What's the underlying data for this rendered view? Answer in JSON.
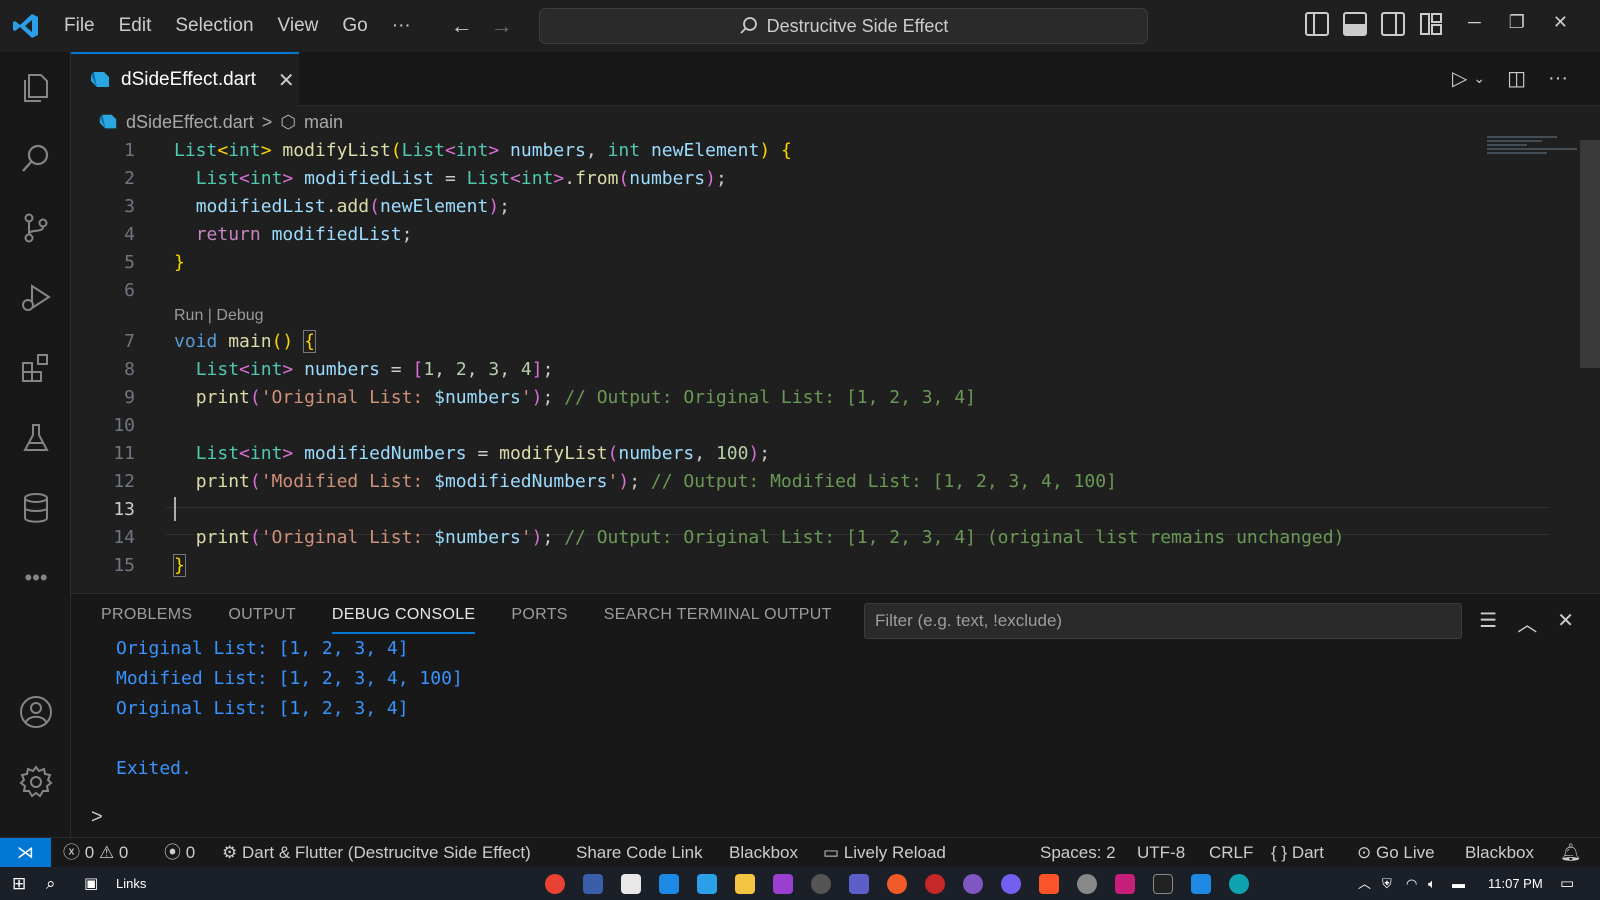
{
  "menu": [
    "File",
    "Edit",
    "Selection",
    "View",
    "Go",
    "···"
  ],
  "search": {
    "label": "Destrucitve Side Effect"
  },
  "tab": {
    "filename": "dSideEffect.dart",
    "close": "✕"
  },
  "breadcrumb": {
    "file": "dSideEffect.dart",
    "sep": ">",
    "symbol": "main"
  },
  "editor": {
    "codelens": "Run | Debug",
    "line_numbers": [
      "1",
      "2",
      "3",
      "4",
      "5",
      "6",
      "7",
      "8",
      "9",
      "10",
      "11",
      "12",
      "13",
      "14",
      "15"
    ],
    "active_line": "13"
  },
  "panel": {
    "tabs": [
      "PROBLEMS",
      "OUTPUT",
      "DEBUG CONSOLE",
      "PORTS",
      "SEARCH TERMINAL OUTPUT"
    ],
    "active_tab": "DEBUG CONSOLE",
    "filter_placeholder": "Filter (e.g. text, !exclude)",
    "console_lines": [
      "Original List: [1, 2, 3, 4]",
      "Modified List: [1, 2, 3, 4, 100]",
      "Original List: [1, 2, 3, 4]",
      "",
      "Exited."
    ],
    "prompt": ">"
  },
  "status": {
    "errors": "0",
    "warnings": "0",
    "ports": "0",
    "debug_target": "Dart & Flutter (Destrucitve Side Effect)",
    "share": "Share Code Link",
    "blackbox1": "Blackbox",
    "lively": "Lively Reload",
    "spaces": "Spaces: 2",
    "encoding": "UTF-8",
    "eol": "CRLF",
    "language": "Dart",
    "golive": "Go Live",
    "blackbox2": "Blackbox"
  },
  "taskbar": {
    "links": "Links",
    "time": "11:07 PM"
  },
  "colors": {
    "accent": "#0078d4",
    "console": "#3794ff"
  }
}
